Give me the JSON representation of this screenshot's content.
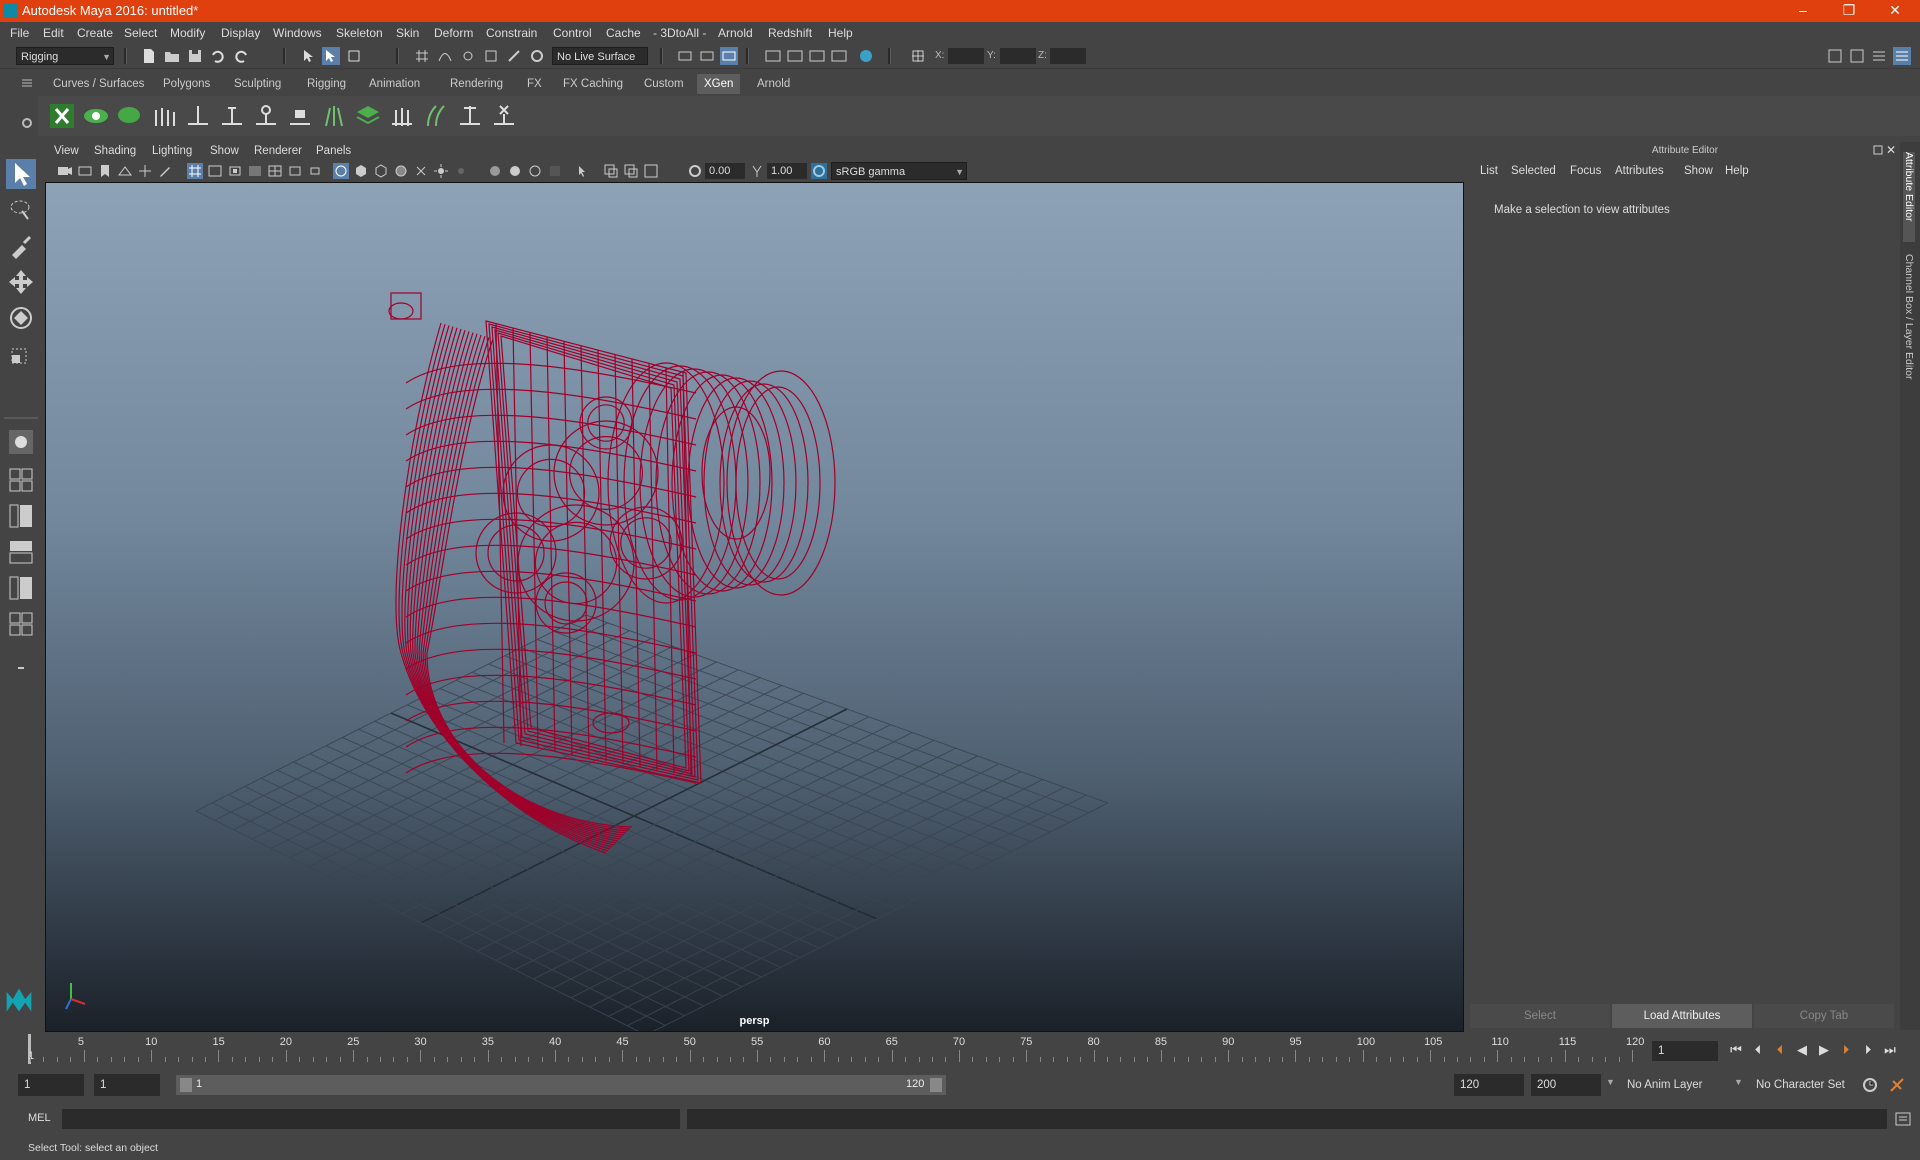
{
  "window": {
    "title": "Autodesk Maya 2016: untitled*",
    "controls": [
      "–",
      "❐",
      "✕"
    ]
  },
  "menubar": [
    "File",
    "Edit",
    "Create",
    "Select",
    "Modify",
    "Display",
    "Windows",
    "Skeleton",
    "Skin",
    "Deform",
    "Constrain",
    "Control",
    "Cache",
    "- 3DtoAll -",
    "Arnold",
    "Redshift",
    "Help"
  ],
  "statusline": {
    "menuset": "Rigging",
    "live_surface": "No Live Surface",
    "coords": [
      "X:",
      "Y:",
      "Z:"
    ]
  },
  "shelf": {
    "tabs": [
      "Curves / Surfaces",
      "Polygons",
      "Sculpting",
      "Rigging",
      "Animation",
      "Rendering",
      "FX",
      "FX Caching",
      "Custom",
      "XGen",
      "Arnold"
    ],
    "active_tab": "XGen"
  },
  "viewport": {
    "menu": [
      "View",
      "Shading",
      "Lighting",
      "Show",
      "Renderer",
      "Panels"
    ],
    "exposure": "0.00",
    "gamma": "1.00",
    "colorspace": "sRGB gamma",
    "camera": "persp"
  },
  "attribute_editor": {
    "header": "Attribute Editor",
    "menu": [
      "List",
      "Selected",
      "Focus",
      "Attributes",
      "Show",
      "Help"
    ],
    "message": "Make a selection to view attributes",
    "buttons": [
      "Select",
      "Load Attributes",
      "Copy Tab"
    ],
    "side_tabs": [
      "Attribute Editor",
      "Channel Box / Layer Editor"
    ]
  },
  "timeline": {
    "ticks": [
      "5",
      "10",
      "15",
      "20",
      "25",
      "30",
      "35",
      "40",
      "45",
      "50",
      "55",
      "60",
      "65",
      "70",
      "75",
      "80",
      "85",
      "90",
      "95",
      "100",
      "105",
      "110",
      "115",
      "120"
    ],
    "start_label": "1",
    "current_frame": "1"
  },
  "range": {
    "start": "1",
    "playback_start": "1",
    "slider_start": "1",
    "slider_end": "120",
    "playback_end": "120",
    "end": "200",
    "anim_layer": "No Anim Layer",
    "character_set": "No Character Set"
  },
  "command": {
    "label": "MEL"
  },
  "help_line": "Select Tool: select an object",
  "colors": {
    "title_bar": "#e0400e",
    "wireframe": "#a0002a",
    "panel": "#444444",
    "active_tool": "#5a7fa8"
  }
}
